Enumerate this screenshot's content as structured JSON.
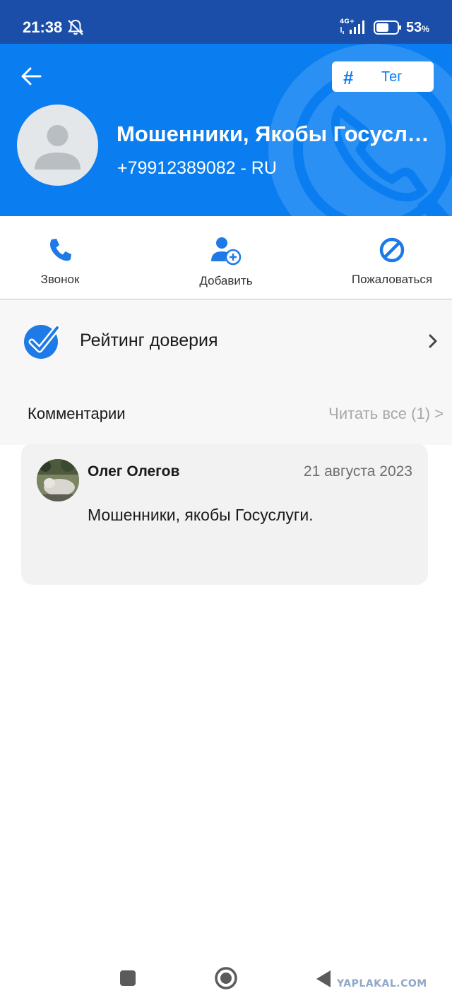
{
  "status_bar": {
    "time": "21:38",
    "network": "4G+",
    "battery_percent": "53",
    "battery_unit": "%",
    "icons": [
      "bell-off-icon",
      "signal-icon",
      "battery-icon"
    ]
  },
  "header": {
    "tag_button": {
      "icon": "hash-icon",
      "label": "Тег"
    },
    "contact_name": "Мошенники, Якобы Госуслуги",
    "contact_phone": "+79912389082 - RU",
    "colors": {
      "background": "#0a7df0",
      "status_bar": "#1a4ea8"
    }
  },
  "actions": [
    {
      "icon": "phone-icon",
      "label": "Звонок"
    },
    {
      "icon": "add-user-icon",
      "label": "Добавить"
    },
    {
      "icon": "block-icon",
      "label": "Пожаловаться"
    }
  ],
  "rating": {
    "icon": "check-shield-icon",
    "label": "Рейтинг доверия"
  },
  "comments": {
    "title": "Комментарии",
    "read_all": "Читать все (1) >",
    "items": [
      {
        "author": "Олег Олегов",
        "date": "21 августа 2023",
        "text": "Мошенники, якобы Госуслуги."
      }
    ]
  },
  "nav_bar": {
    "icons": [
      "recents-square-icon",
      "home-circle-icon",
      "back-triangle-icon"
    ]
  },
  "watermark": "YAPLAKAL.COM"
}
